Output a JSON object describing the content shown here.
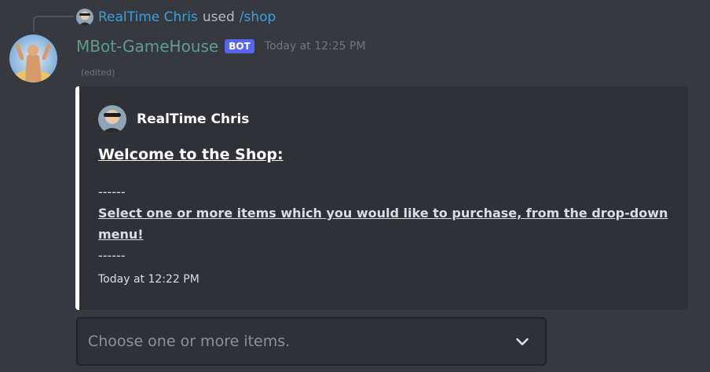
{
  "reply": {
    "user": "RealTime Chris",
    "used_text": "used",
    "command": "/shop"
  },
  "message": {
    "author": "MBot-GameHouse",
    "bot_tag": "BOT",
    "timestamp": "Today at 12:25 PM",
    "edited": "(edited)"
  },
  "embed": {
    "author": "RealTime Chris",
    "title": "Welcome to the Shop:",
    "separator_top": "------",
    "description": "Select one or more items which you would like to purchase, from the drop-down menu!",
    "separator_bottom": "------",
    "footer": "Today at 12:22 PM",
    "border_color": "#ffffff"
  },
  "select_menu": {
    "placeholder": "Choose one or more items.",
    "icon": "chevron-down-icon"
  },
  "colors": {
    "background": "#36393f",
    "embed_bg": "#2f3136",
    "bot_tag": "#5865f2",
    "author_name": "#5f9e84",
    "link": "#3aa0dc"
  }
}
